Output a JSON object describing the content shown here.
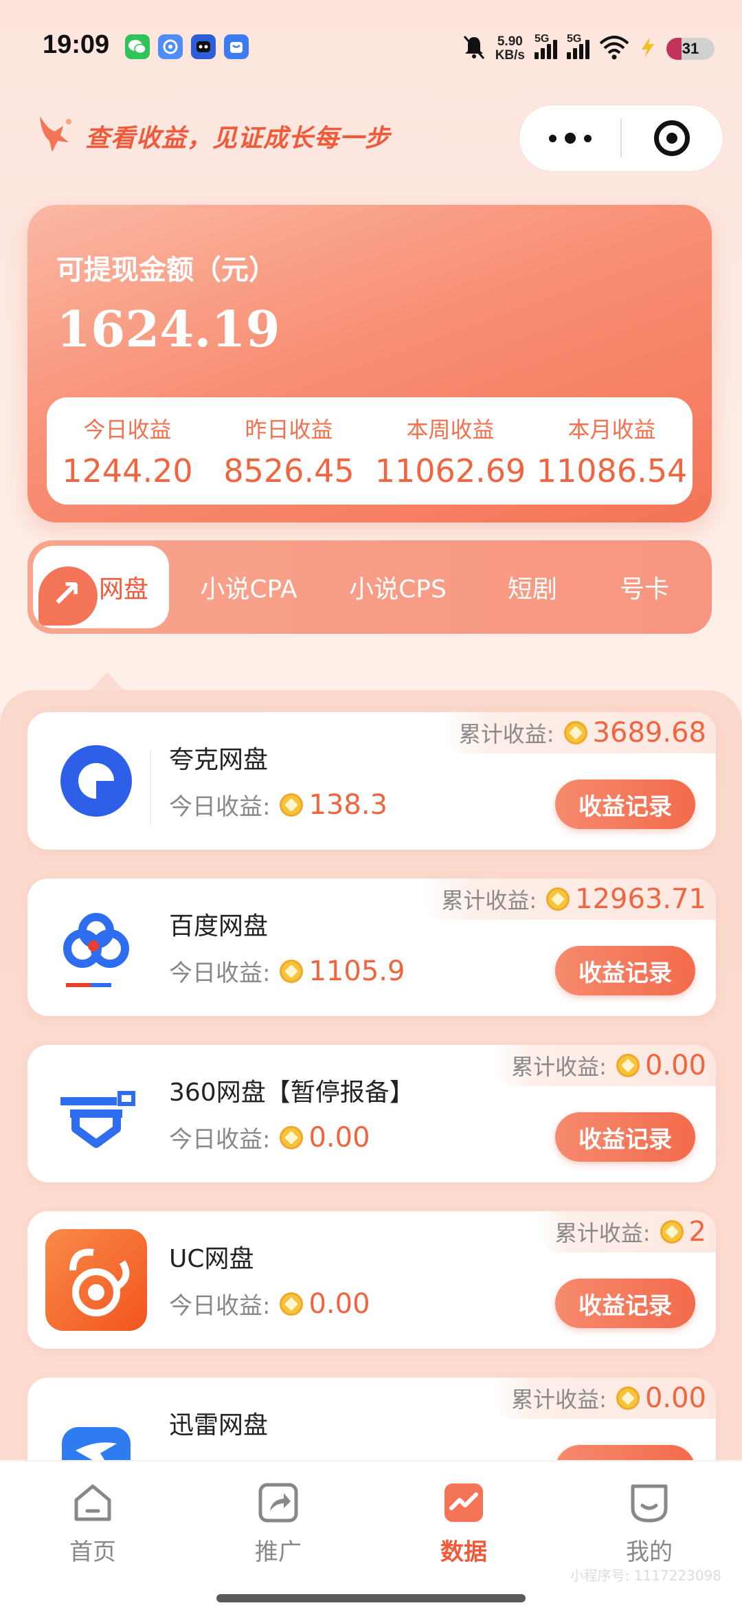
{
  "status_bar": {
    "time": "19:09",
    "net_speed_value": "5.90",
    "net_speed_unit": "KB/s",
    "signal1_label": "5G",
    "signal2_label": "5G",
    "battery": "31",
    "battery_level": 0.31
  },
  "header": {
    "slogan": "查看收益，见证成长每一步"
  },
  "balance": {
    "label": "可提现金额（元）",
    "amount": "1624.19",
    "stats": [
      {
        "label": "今日收益",
        "value": "1244.20"
      },
      {
        "label": "昨日收益",
        "value": "8526.45"
      },
      {
        "label": "本周收益",
        "value": "11062.69"
      },
      {
        "label": "本月收益",
        "value": "11086.54"
      }
    ]
  },
  "tabs": [
    {
      "label": "网盘",
      "active": true
    },
    {
      "label": "小说CPA"
    },
    {
      "label": "小说CPS"
    },
    {
      "label": "短剧"
    },
    {
      "label": "号卡"
    }
  ],
  "list": {
    "today_label": "今日收益:",
    "total_label": "累计收益:",
    "button_label": "收益记录",
    "items": [
      {
        "name": "夸克网盘",
        "today": "138.3",
        "total": "3689.68",
        "icon": "quark-icon"
      },
      {
        "name": "百度网盘",
        "today": "1105.9",
        "total": "12963.71",
        "icon": "baidu-pan-icon"
      },
      {
        "name": "360网盘【暂停报备】",
        "today": "0.00",
        "total": "0.00",
        "icon": "360-pan-icon"
      },
      {
        "name": "UC网盘",
        "today": "0.00",
        "total": "2",
        "icon": "uc-pan-icon"
      },
      {
        "name": "迅雷网盘",
        "today": "",
        "total": "0.00",
        "icon": "xunlei-icon"
      }
    ]
  },
  "nav": [
    {
      "label": "首页",
      "icon": "home-icon"
    },
    {
      "label": "推广",
      "icon": "share-icon"
    },
    {
      "label": "数据",
      "icon": "chart-icon",
      "active": true
    },
    {
      "label": "我的",
      "icon": "profile-icon"
    }
  ],
  "watermark": "小程序号: 1117223098",
  "colors": {
    "accent": "#f05a3a",
    "card_gradient_start": "#fbb8a4",
    "card_gradient_end": "#f47457"
  }
}
